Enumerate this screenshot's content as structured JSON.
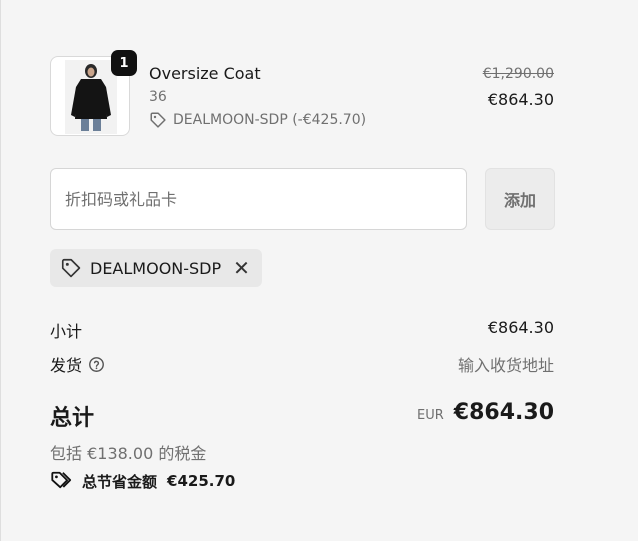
{
  "cart": {
    "item": {
      "quantity": "1",
      "name": "Oversize Coat",
      "variant": "36",
      "discount": "DEALMOON-SDP (-€425.70)",
      "original_price": "€1,290.00",
      "price": "€864.30"
    }
  },
  "discount_form": {
    "placeholder": "折扣码或礼品卡",
    "value": "",
    "apply_label": "添加"
  },
  "applied_code": {
    "code": "DEALMOON-SDP"
  },
  "summary": {
    "subtotal_label": "小计",
    "subtotal_value": "€864.30",
    "shipping_label": "发货",
    "shipping_value": "输入收货地址",
    "total_label": "总计",
    "currency": "EUR",
    "total_value": "€864.30",
    "tax_note": "包括 €138.00 的税金",
    "savings_label": "总节省金额",
    "savings_value": "€425.70"
  },
  "icons": {
    "tag": "tag-icon",
    "help": "help-circle-icon",
    "remove": "close-icon",
    "savings": "tags-icon"
  },
  "colors": {
    "background": "#f5f5f5",
    "badge": "#111111",
    "muted_text": "#707070"
  }
}
